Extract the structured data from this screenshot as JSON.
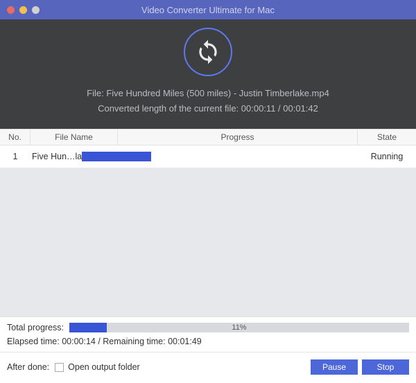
{
  "window": {
    "title": "Video Converter Ultimate for Mac"
  },
  "hero": {
    "file_line": "File: Five Hundred Miles (500 miles) - Justin Timberlake.mp4",
    "convert_line": "Converted length of the current file: 00:00:11 / 00:01:42"
  },
  "columns": {
    "no": "No.",
    "file": "File Name",
    "progress": "Progress",
    "state": "State"
  },
  "rows": [
    {
      "no": "1",
      "file": "Five Hun…lake.mp4",
      "progress_percent": 11,
      "state": "Running"
    }
  ],
  "total": {
    "label": "Total progress:",
    "percent_text": "11%",
    "percent": 11,
    "time_line": "Elapsed time: 00:00:14 / Remaining time: 00:01:49"
  },
  "after_done": {
    "label": "After done:",
    "checkbox_label": "Open output folder",
    "checked": false
  },
  "buttons": {
    "pause": "Pause",
    "stop": "Stop"
  }
}
